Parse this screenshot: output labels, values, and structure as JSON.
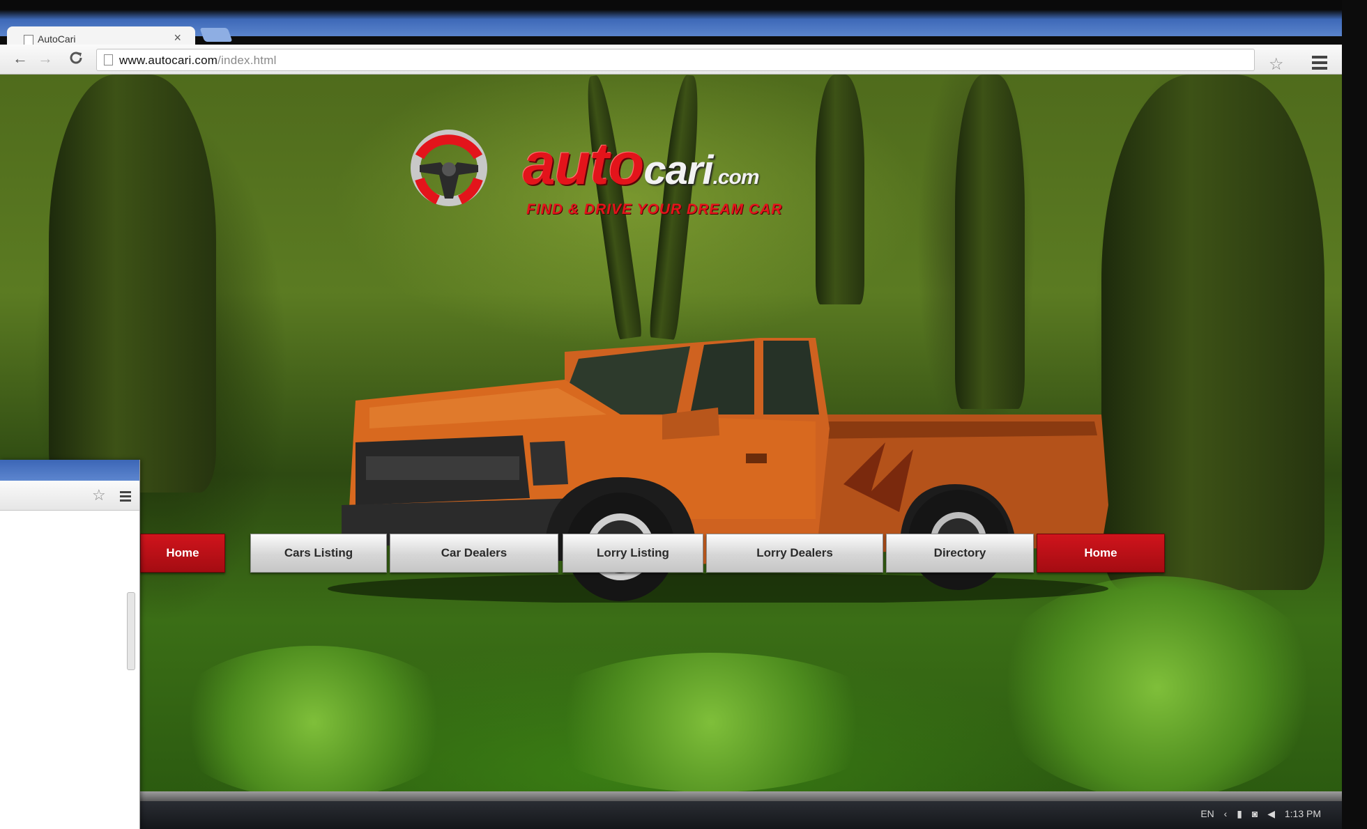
{
  "browser": {
    "tab_title": "AutoCari",
    "tab_close": "×",
    "url_host": "www.autocari.com",
    "url_path": "/index.html",
    "star_icon": "☆",
    "back_icon": "←",
    "forward_icon": "→",
    "reload_icon": "C"
  },
  "site": {
    "logo_word": "auto",
    "logo_cari": "cari",
    "logo_com": ".com",
    "tagline": "FIND & DRIVE YOUR DREAM CAR"
  },
  "nav": {
    "items": [
      {
        "label": "Home",
        "style": "red"
      },
      {
        "label": "Cars Listing",
        "style": "grey"
      },
      {
        "label": "Car Dealers",
        "style": "grey"
      },
      {
        "label": "Lorry Listing",
        "style": "grey"
      },
      {
        "label": "Lorry Dealers",
        "style": "grey"
      },
      {
        "label": "Directory",
        "style": "grey"
      },
      {
        "label": "Home",
        "style": "red"
      }
    ]
  },
  "taskbar": {
    "language": "EN",
    "time": "1:13 PM"
  },
  "colors": {
    "accent_red": "#d0141c",
    "tab_blue": "#3e69b8",
    "truck_orange": "#d2621c"
  }
}
